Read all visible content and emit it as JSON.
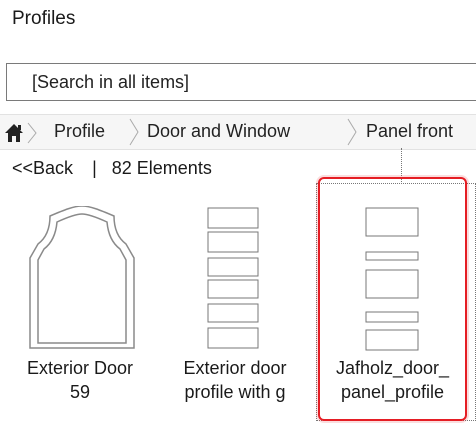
{
  "panel": {
    "title": "Profiles"
  },
  "search": {
    "placeholder": "[Search in all items]"
  },
  "breadcrumb": {
    "home_icon": "home-icon",
    "items": [
      "Profile",
      "Door and Window",
      "Panel front"
    ]
  },
  "nav": {
    "back_label": "<<Back",
    "separator": "|",
    "count_label": "82 Elements"
  },
  "items": [
    {
      "line1": "Exterior Door",
      "line2": "59",
      "icon": "arched-door-profile-thumbnail"
    },
    {
      "line1": "Exterior door",
      "line2": "profile with g",
      "icon": "stacked-panels-profile-thumbnail"
    },
    {
      "line1": "Jafholz_door_",
      "line2": "panel_profile",
      "icon": "panel-profile-thumbnail",
      "selected": true
    }
  ],
  "colors": {
    "selection_border": "#e51d24",
    "text": "#1a1a1a"
  }
}
